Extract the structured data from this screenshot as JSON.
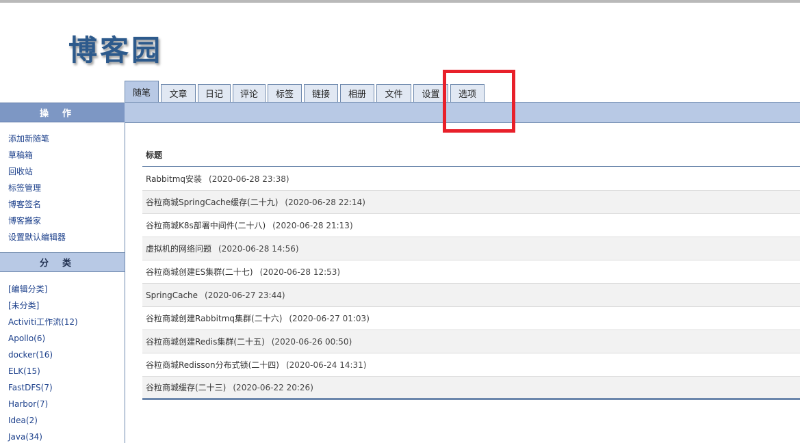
{
  "logo_text": "博客园",
  "tabs": [
    {
      "label": "随笔",
      "active": true
    },
    {
      "label": "文章"
    },
    {
      "label": "日记"
    },
    {
      "label": "评论"
    },
    {
      "label": "标签"
    },
    {
      "label": "链接"
    },
    {
      "label": "相册"
    },
    {
      "label": "文件"
    },
    {
      "label": "设置"
    },
    {
      "label": "选项"
    }
  ],
  "sidebar": {
    "ops_header": "操作",
    "ops_items": [
      "添加新随笔",
      "草稿箱",
      "回收站",
      "标签管理",
      "博客签名",
      "博客搬家",
      "设置默认编辑器"
    ],
    "cat_header": "分类",
    "cat_items": [
      "[编辑分类]",
      "[未分类]",
      "Activiti工作流(12)",
      "Apollo(6)",
      "docker(16)",
      "ELK(15)",
      "FastDFS(7)",
      "Harbor(7)",
      "Idea(2)",
      "Java(34)"
    ]
  },
  "table": {
    "column_title": "标题",
    "rows": [
      {
        "title": "Rabbitmq安装",
        "date": "(2020-06-28 23:38)"
      },
      {
        "title": "谷粒商城SpringCache缓存(二十九)",
        "date": "(2020-06-28 22:14)"
      },
      {
        "title": "谷粒商城K8s部署中间件(二十八)",
        "date": "(2020-06-28 21:13)"
      },
      {
        "title": "虚拟机的网络问题",
        "date": "(2020-06-28 14:56)"
      },
      {
        "title": "谷粒商城创建ES集群(二十七)",
        "date": "(2020-06-28 12:53)"
      },
      {
        "title": "SpringCache",
        "date": "(2020-06-27 23:44)"
      },
      {
        "title": "谷粒商城创建Rabbitmq集群(二十六)",
        "date": "(2020-06-27 01:03)"
      },
      {
        "title": "谷粒商城创建Redis集群(二十五)",
        "date": "(2020-06-26 00:50)"
      },
      {
        "title": "谷粒商城Redisson分布式锁(二十四)",
        "date": "(2020-06-24 14:31)"
      },
      {
        "title": "谷粒商城缓存(二十三)",
        "date": "(2020-06-22 20:26)"
      }
    ]
  },
  "colors": {
    "accent_blue": "#b8c9e5",
    "header_blue": "#7d97c4",
    "highlight_red": "#e8202a"
  }
}
